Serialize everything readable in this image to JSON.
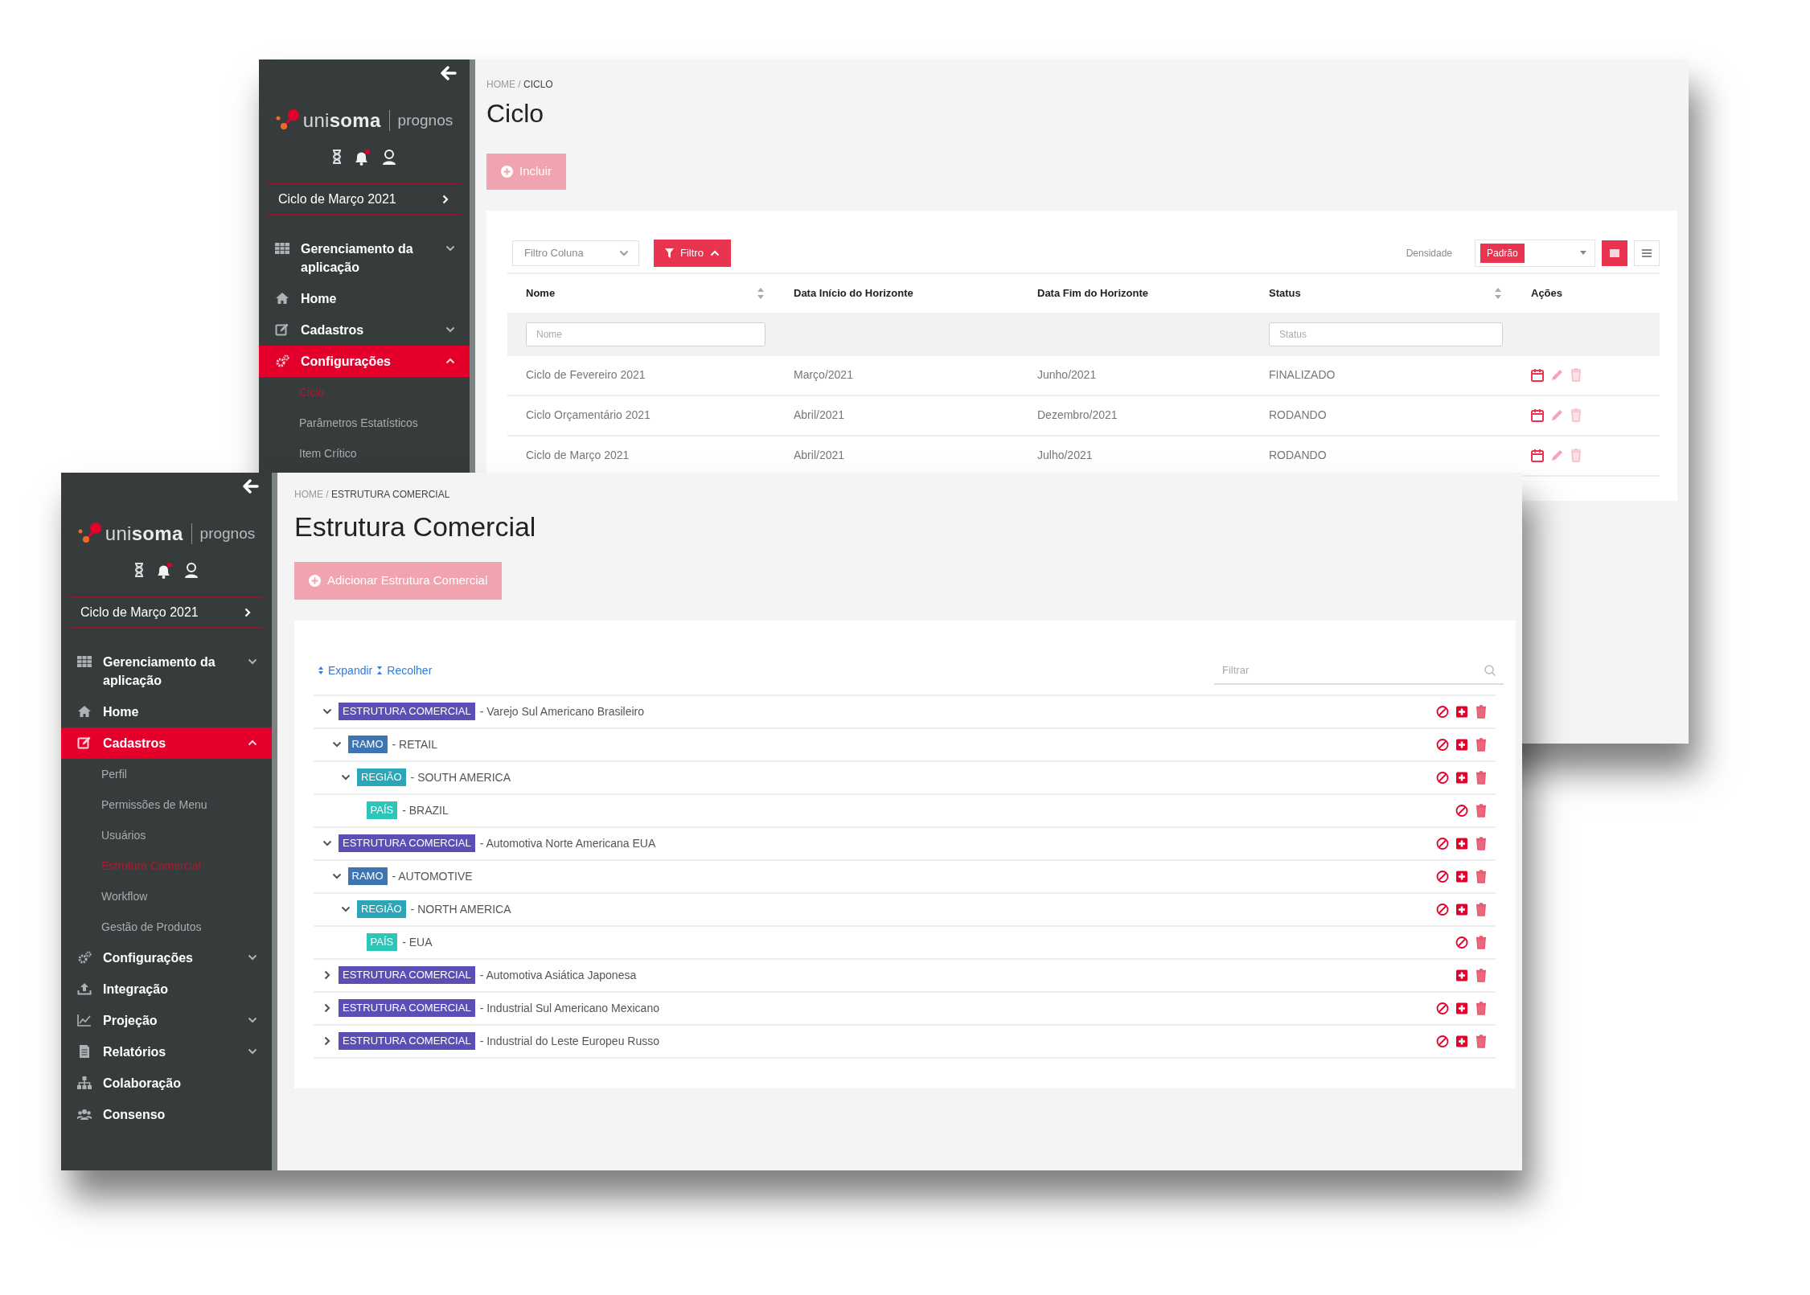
{
  "back_window": {
    "sidebar": {
      "brand": "uni**soma**",
      "product": "prognos",
      "cycle": "Ciclo de Março 2021",
      "items": [
        {
          "label": "Gerenciamento da aplicação",
          "selected": false,
          "expanded": false
        },
        {
          "label": "Home",
          "selected": false
        },
        {
          "label": "Cadastros",
          "selected": false,
          "expanded": false
        },
        {
          "label": "Configurações",
          "selected": true,
          "expanded": true,
          "children": [
            {
              "label": "Ciclo",
              "selected": true
            },
            {
              "label": "Parâmetros Estatísticos",
              "selected": false
            },
            {
              "label": "Item Crítico",
              "selected": false
            }
          ]
        }
      ]
    },
    "breadcrumb": "HOME / **CICLO**",
    "title": "Ciclo",
    "add_button": {
      "label": "Incluir",
      "disabled": true
    },
    "toolbar": {
      "column_filter": "Filtro Coluna",
      "filter_button": {
        "label": "Filtro",
        "expanded": true
      },
      "density_label": "Densidade",
      "density": "Padrão",
      "views": [
        {
          "selected": true
        },
        {
          "selected": false
        }
      ]
    },
    "table": {
      "columns": [
        {
          "label": "Nome",
          "sortable": true,
          "filter_placeholder": "Nome"
        },
        {
          "label": "Data Início do Horizonte",
          "sortable": false
        },
        {
          "label": "Data Fim do Horizonte",
          "sortable": false
        },
        {
          "label": "Status",
          "sortable": true,
          "filter_placeholder": "Status"
        },
        {
          "label": "Ações",
          "sortable": false
        }
      ],
      "rows": [
        [
          "Ciclo de Fevereiro 2021",
          "Março/2021",
          "Junho/2021",
          "FINALIZADO"
        ],
        [
          "Ciclo Orçamentário 2021",
          "Abril/2021",
          "Dezembro/2021",
          "RODANDO"
        ],
        [
          "Ciclo de Março 2021",
          "Abril/2021",
          "Julho/2021",
          "RODANDO"
        ]
      ]
    }
  },
  "front_window": {
    "sidebar": {
      "brand": "uni**soma**",
      "product": "prognos",
      "cycle": "Ciclo de Março 2021",
      "items": [
        {
          "label": "Gerenciamento da aplicação",
          "selected": false,
          "expanded": false
        },
        {
          "label": "Home",
          "selected": false
        },
        {
          "label": "Cadastros",
          "selected": true,
          "expanded": true,
          "children": [
            {
              "label": "Perfil",
              "selected": false
            },
            {
              "label": "Permissões de Menu",
              "selected": false
            },
            {
              "label": "Usuários",
              "selected": false
            },
            {
              "label": "Estrutura Comercial",
              "selected": true
            },
            {
              "label": "Workflow",
              "selected": false
            },
            {
              "label": "Gestão de Produtos",
              "selected": false
            }
          ]
        },
        {
          "label": "Configurações",
          "selected": false,
          "expanded": false
        },
        {
          "label": "Integração",
          "selected": false
        },
        {
          "label": "Projeção",
          "selected": false,
          "expanded": false
        },
        {
          "label": "Relatórios",
          "selected": false,
          "expanded": false
        },
        {
          "label": "Colaboração",
          "selected": false
        },
        {
          "label": "Consenso",
          "selected": false
        }
      ]
    },
    "breadcrumb": "HOME / **ESTRUTURA COMERCIAL**",
    "title": "Estrutura Comercial",
    "add_button": {
      "label": "Adicionar Estrutura Comercial",
      "disabled": true
    },
    "tree": {
      "expand_link": "Expandir",
      "collapse_link": "Recolher",
      "filter_placeholder": "Filtrar",
      "nodes": [
        {
          "tag": "ESTRUTURA COMERCIAL",
          "color": "#5b4fb6",
          "name": "- Varejo Sul Americano Brasileiro",
          "can_block": true,
          "can_add": true,
          "expanded": true,
          "children": [
            {
              "tag": "RAMO",
              "color": "#3f74b3",
              "name": "- RETAIL",
              "can_block": true,
              "can_add": true,
              "expanded": true,
              "children": [
                {
                  "tag": "REGIÃO",
                  "color": "#29a7b8",
                  "name": "- SOUTH AMERICA",
                  "can_block": true,
                  "can_add": true,
                  "expanded": true,
                  "children": [
                    {
                      "tag": "PAÍS",
                      "color": "#2ec5b9",
                      "name": "- BRAZIL",
                      "can_block": true,
                      "can_add": false
                    }
                  ]
                }
              ]
            }
          ]
        },
        {
          "tag": "ESTRUTURA COMERCIAL",
          "color": "#5b4fb6",
          "name": "- Automotiva Norte Americana EUA",
          "can_block": true,
          "can_add": true,
          "expanded": true,
          "children": [
            {
              "tag": "RAMO",
              "color": "#3f74b3",
              "name": "- AUTOMOTIVE",
              "can_block": true,
              "can_add": true,
              "expanded": true,
              "children": [
                {
                  "tag": "REGIÃO",
                  "color": "#29a7b8",
                  "name": "- NORTH AMERICA",
                  "can_block": true,
                  "can_add": true,
                  "expanded": true,
                  "children": [
                    {
                      "tag": "PAÍS",
                      "color": "#2ec5b9",
                      "name": "- EUA",
                      "can_block": true,
                      "can_add": false
                    }
                  ]
                }
              ]
            }
          ]
        },
        {
          "tag": "ESTRUTURA COMERCIAL",
          "color": "#5b4fb6",
          "name": "- Automotiva Asiática Japonesa",
          "can_block": false,
          "can_add": true,
          "expanded": false
        },
        {
          "tag": "ESTRUTURA COMERCIAL",
          "color": "#5b4fb6",
          "name": "- Industrial Sul Americano Mexicano",
          "can_block": true,
          "can_add": true,
          "expanded": false
        },
        {
          "tag": "ESTRUTURA COMERCIAL",
          "color": "#5b4fb6",
          "name": "- Industrial do Leste Europeu Russo",
          "can_block": true,
          "can_add": true,
          "expanded": false
        }
      ]
    }
  }
}
